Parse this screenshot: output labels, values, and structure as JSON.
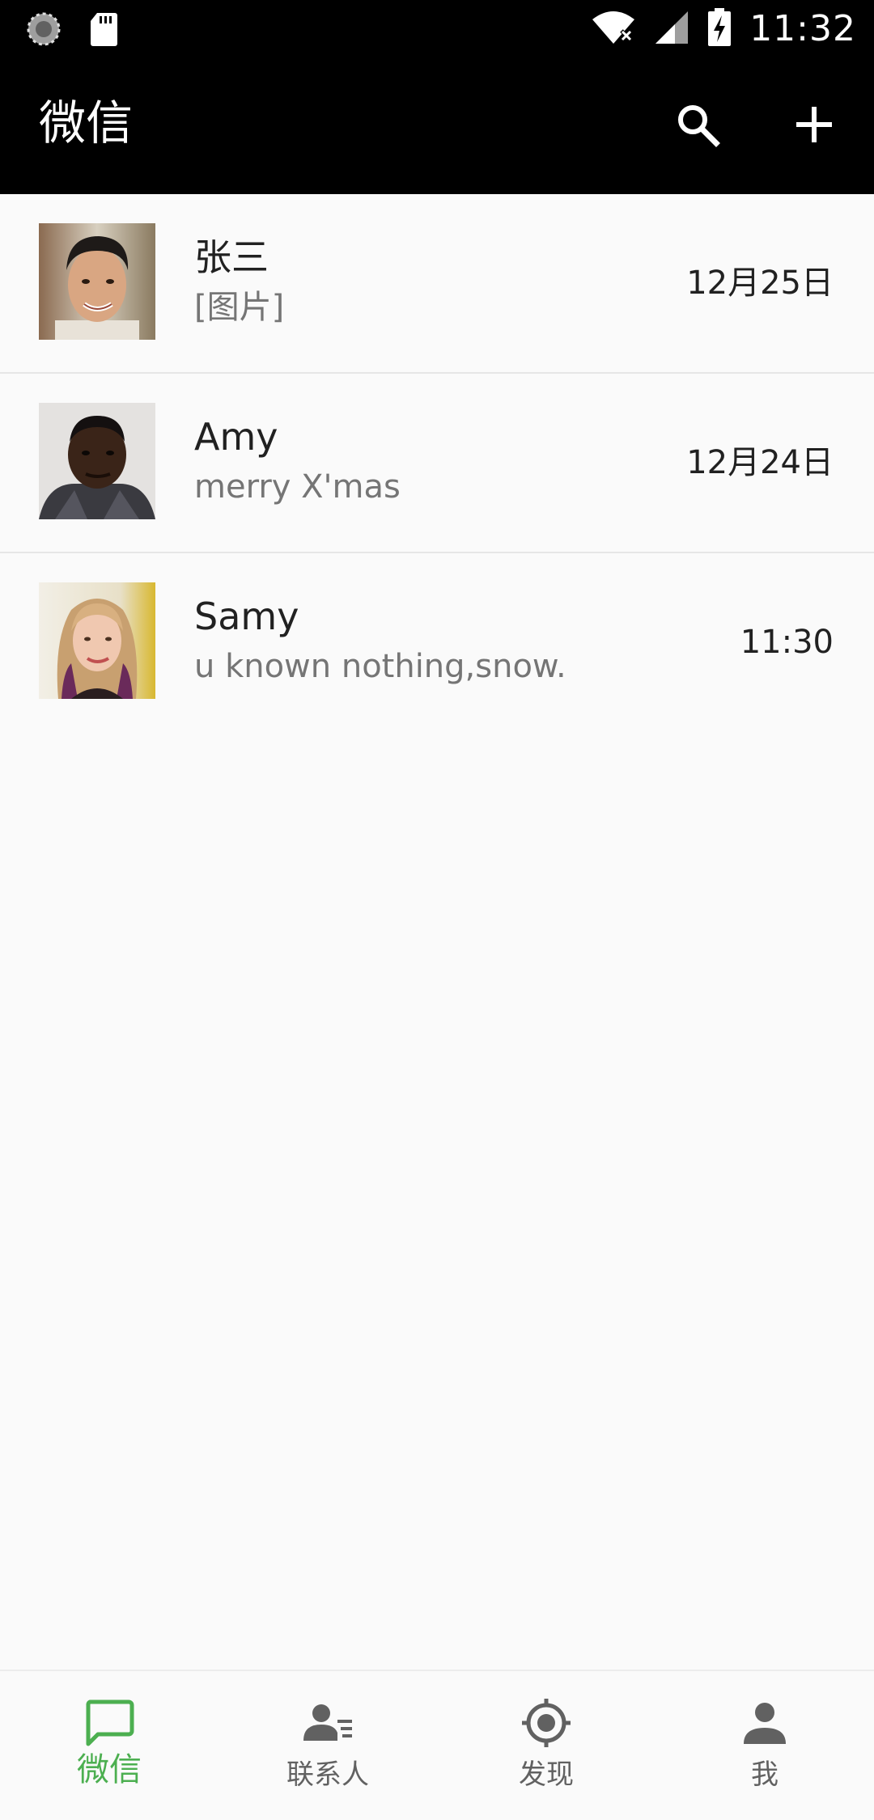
{
  "status_bar": {
    "time": "11:32"
  },
  "app_bar": {
    "title": "微信",
    "actions": [
      "search-icon",
      "add-icon"
    ]
  },
  "chats": [
    {
      "name": "张三",
      "preview": "[图片]",
      "time": "12月25日"
    },
    {
      "name": "Amy",
      "preview": "merry X'mas",
      "time": "12月24日"
    },
    {
      "name": "Samy",
      "preview": "u known nothing,snow.",
      "time": "11:30"
    }
  ],
  "bottom_nav": {
    "items": [
      {
        "label": "微信",
        "icon": "chat-icon",
        "active": true
      },
      {
        "label": "联系人",
        "icon": "contacts-icon",
        "active": false
      },
      {
        "label": "发现",
        "icon": "discover-icon",
        "active": false
      },
      {
        "label": "我",
        "icon": "person-icon",
        "active": false
      }
    ]
  },
  "colors": {
    "bar_background": "#000000",
    "page_background": "#fafafa",
    "accent": "#4caf50",
    "text_primary": "#212121",
    "text_secondary": "#757575",
    "nav_inactive": "#616161"
  }
}
